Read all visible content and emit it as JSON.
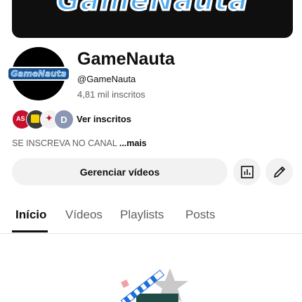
{
  "banner": {
    "logo_text": "GameNauta"
  },
  "channel": {
    "avatar_logo_text": "GameNauta",
    "name": "GameNauta",
    "handle": "@GameNauta",
    "subscribers": "4,81 mil inscritos",
    "subscriber_avatar_last": "D",
    "view_subscribers_label": "Ver inscritos",
    "description": "SE INSCREVA NO CANAL",
    "more_label": "...mais"
  },
  "actions": {
    "manage_videos_label": "Gerenciar vídeos",
    "analytics_icon": "analytics-icon",
    "edit_icon": "pencil-icon"
  },
  "tabs": [
    {
      "label": "Início",
      "active": true
    },
    {
      "label": "Vídeos",
      "active": false
    },
    {
      "label": "Playlists",
      "active": false
    },
    {
      "label": "Posts",
      "active": false
    }
  ],
  "colors": {
    "background": "#ffffff",
    "text_primary": "#0f0f0f",
    "text_secondary": "#606060",
    "button_bg": "#f2f2f2",
    "logo_blue": "#4aa8f0"
  }
}
